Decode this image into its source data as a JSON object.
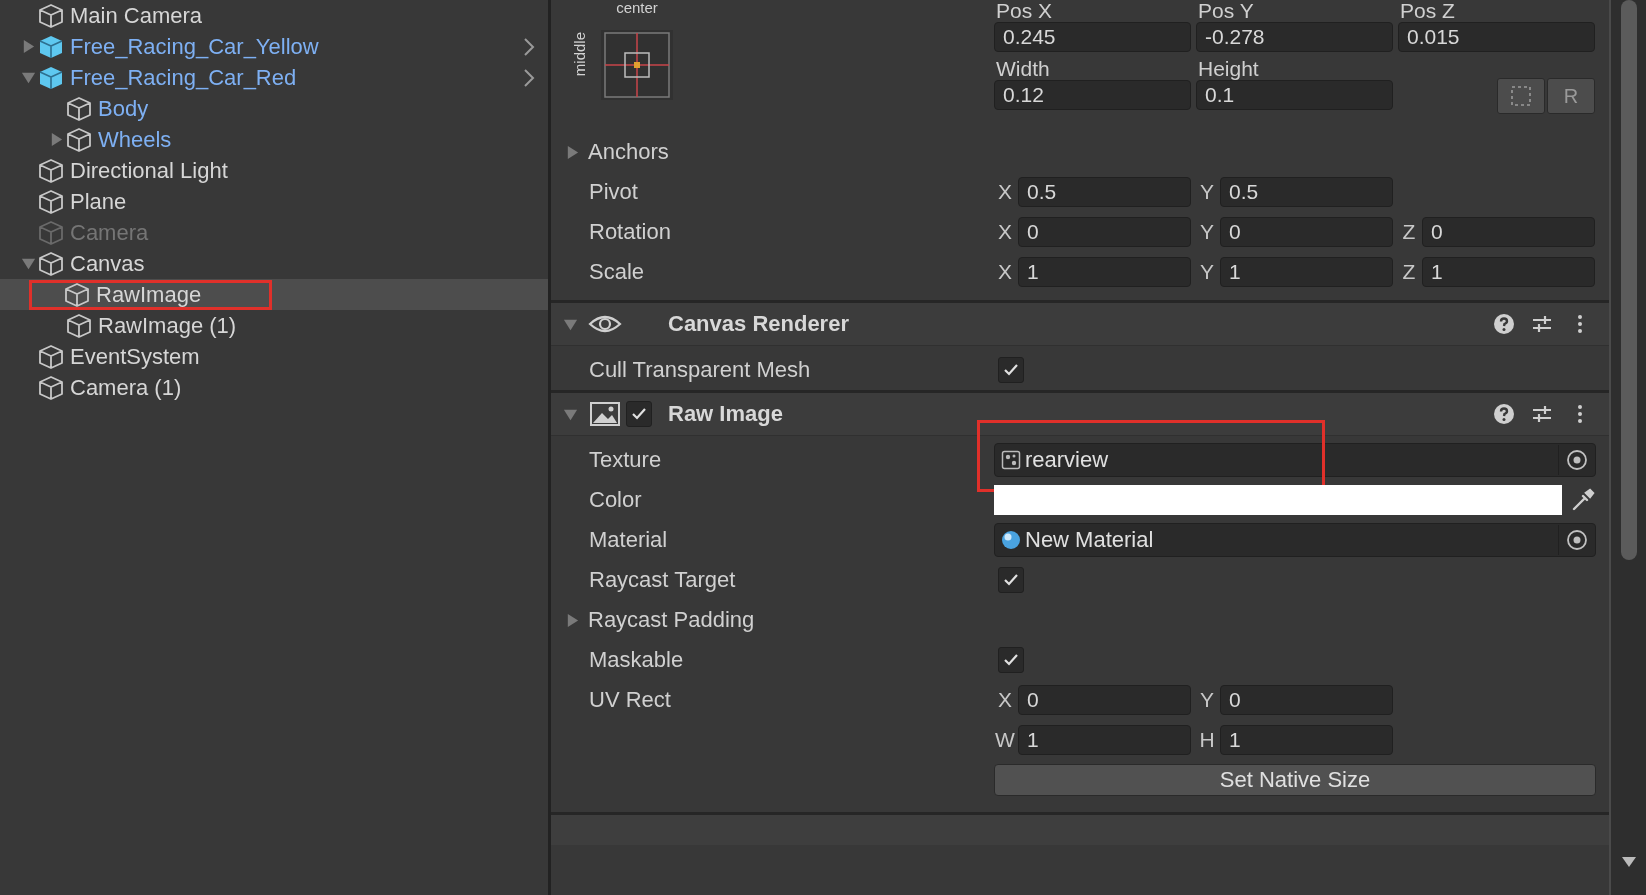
{
  "hierarchy": {
    "items": [
      {
        "label": "Main Camera",
        "kind": "normal",
        "selected": false
      },
      {
        "label": "Free_Racing_Car_Yellow",
        "kind": "prefab-root",
        "selected": false,
        "expanded": false
      },
      {
        "label": "Free_Racing_Car_Red",
        "kind": "prefab-root",
        "selected": false,
        "expanded": true,
        "children": [
          {
            "label": "Body",
            "kind": "prefab-part",
            "selected": false
          },
          {
            "label": "Wheels",
            "kind": "prefab-part",
            "selected": false,
            "expanded": false
          }
        ]
      },
      {
        "label": "Directional Light",
        "kind": "normal",
        "selected": false
      },
      {
        "label": "Plane",
        "kind": "normal",
        "selected": false
      },
      {
        "label": "Camera",
        "kind": "inactive",
        "selected": false
      },
      {
        "label": "Canvas",
        "kind": "normal",
        "selected": false,
        "expanded": true,
        "children": [
          {
            "label": "RawImage",
            "kind": "normal",
            "selected": true,
            "marked": true
          },
          {
            "label": "RawImage (1)",
            "kind": "normal",
            "selected": false
          }
        ]
      },
      {
        "label": "EventSystem",
        "kind": "normal",
        "selected": false
      },
      {
        "label": "Camera (1)",
        "kind": "normal",
        "selected": false
      }
    ]
  },
  "rect_transform": {
    "anchor_preset": {
      "horizontal": "center",
      "vertical": "middle"
    },
    "position_fields": [
      {
        "label": "Pos X",
        "value": "0.245"
      },
      {
        "label": "Pos Y",
        "value": "-0.278"
      },
      {
        "label": "Pos Z",
        "value": "0.015"
      }
    ],
    "size_fields": [
      {
        "label": "Width",
        "value": "0.12"
      },
      {
        "label": "Height",
        "value": "0.1"
      }
    ],
    "buttons": [
      {
        "kind": "blueprint"
      },
      {
        "kind": "raw",
        "label": "R"
      }
    ],
    "rows": [
      {
        "kind": "foldout",
        "label": "Anchors",
        "expanded": false
      },
      {
        "kind": "vector",
        "label": "Pivot",
        "fields": [
          {
            "axis": "X",
            "value": "0.5"
          },
          {
            "axis": "Y",
            "value": "0.5"
          }
        ]
      },
      {
        "kind": "vector",
        "label": "Rotation",
        "fields": [
          {
            "axis": "X",
            "value": "0"
          },
          {
            "axis": "Y",
            "value": "0"
          },
          {
            "axis": "Z",
            "value": "0"
          }
        ]
      },
      {
        "kind": "vector",
        "label": "Scale",
        "fields": [
          {
            "axis": "X",
            "value": "1"
          },
          {
            "axis": "Y",
            "value": "1"
          },
          {
            "axis": "Z",
            "value": "1"
          }
        ]
      }
    ]
  },
  "components": [
    {
      "title": "Canvas Renderer",
      "expanded": true,
      "properties": [
        {
          "kind": "checkbox",
          "label": "Cull Transparent Mesh",
          "checked": true
        }
      ]
    },
    {
      "title": "Raw Image",
      "enabled": true,
      "expanded": true,
      "properties": [
        {
          "kind": "texture",
          "label": "Texture",
          "value": "rearview",
          "marked": true
        },
        {
          "kind": "color",
          "label": "Color",
          "color": "#ffffff"
        },
        {
          "kind": "material",
          "label": "Material",
          "value": "New Material"
        },
        {
          "kind": "checkbox",
          "label": "Raycast Target",
          "checked": true
        },
        {
          "kind": "foldout",
          "label": "Raycast Padding",
          "expanded": false
        },
        {
          "kind": "checkbox",
          "label": "Maskable",
          "checked": true
        },
        {
          "kind": "vector",
          "label": "UV Rect",
          "fields": [
            {
              "axis": "X",
              "value": "0"
            },
            {
              "axis": "Y",
              "value": "0"
            }
          ]
        },
        {
          "kind": "vector",
          "fields": [
            {
              "axis": "W",
              "value": "1"
            },
            {
              "axis": "H",
              "value": "1"
            }
          ]
        },
        {
          "kind": "button",
          "label": "Set Native Size"
        }
      ]
    }
  ]
}
